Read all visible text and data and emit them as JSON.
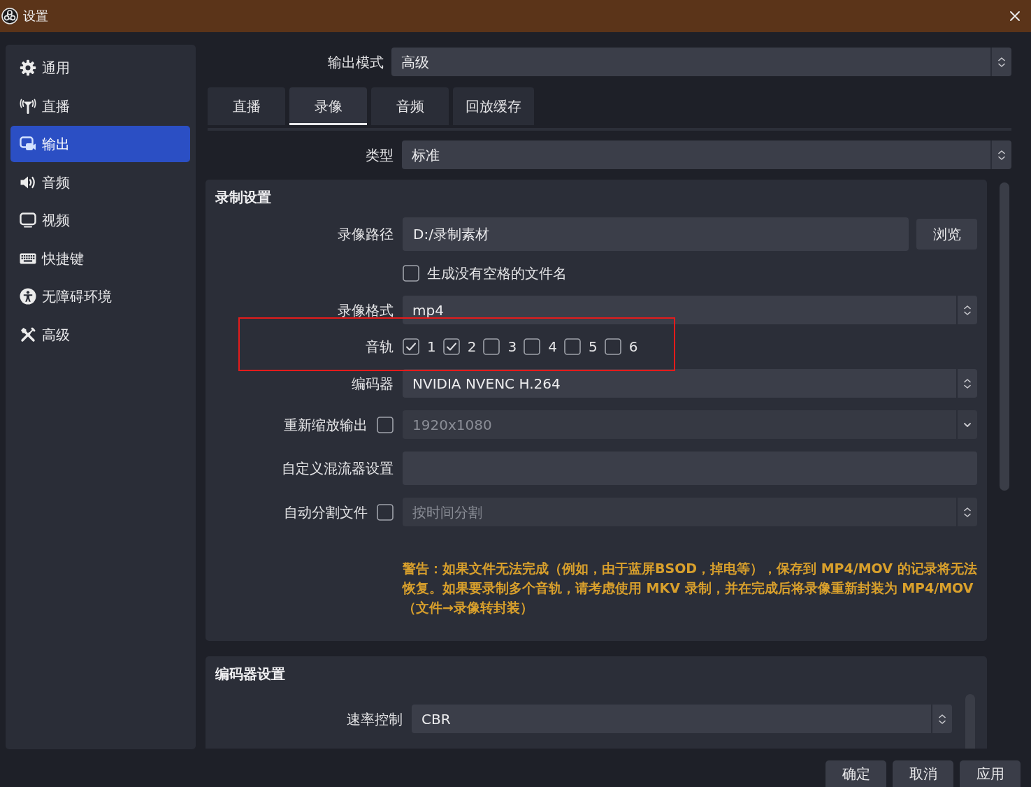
{
  "window": {
    "title": "设置"
  },
  "sidebar": {
    "items": [
      {
        "label": "通用",
        "selected": false
      },
      {
        "label": "直播",
        "selected": false
      },
      {
        "label": "输出",
        "selected": true
      },
      {
        "label": "音频",
        "selected": false
      },
      {
        "label": "视频",
        "selected": false
      },
      {
        "label": "快捷键",
        "selected": false
      },
      {
        "label": "无障碍环境",
        "selected": false
      },
      {
        "label": "高级",
        "selected": false
      }
    ]
  },
  "output_mode": {
    "kind": "field",
    "label": "输出模式",
    "field": {
      "kind": "select",
      "value": "高级",
      "disabled": false
    }
  },
  "tabs": [
    {
      "label": "直播",
      "selected": false
    },
    {
      "label": "录像",
      "selected": true
    },
    {
      "label": "音频",
      "selected": false
    },
    {
      "label": "回放缓存",
      "selected": false
    }
  ],
  "recording_type": {
    "kind": "field",
    "label": "类型",
    "field": {
      "kind": "select",
      "value": "标准",
      "disabled": false
    }
  },
  "recording_settings": {
    "title": "录制设置",
    "rows": [
      {
        "kind": "field",
        "label": "录像路径",
        "field": {
          "kind": "text",
          "value": "D:/录制素材",
          "disabled": false
        },
        "button": "浏览"
      },
      {
        "kind": "checkbox",
        "label": "生成没有空格的文件名",
        "checked": false
      },
      {
        "kind": "field",
        "label": "录像格式",
        "field": {
          "kind": "select",
          "value": "mp4",
          "disabled": false
        }
      },
      {
        "kind": "tracks",
        "label": "音轨",
        "highlighted": true,
        "tracks": [
          {
            "label": "1",
            "checked": true
          },
          {
            "label": "2",
            "checked": true
          },
          {
            "label": "3",
            "checked": false
          },
          {
            "label": "4",
            "checked": false
          },
          {
            "label": "5",
            "checked": false
          },
          {
            "label": "6",
            "checked": false
          }
        ]
      },
      {
        "kind": "field",
        "label": "编码器",
        "field": {
          "kind": "select",
          "value": "NVIDIA NVENC H.264",
          "disabled": false
        }
      },
      {
        "kind": "field",
        "label": "重新缩放输出",
        "checked": false,
        "field": {
          "kind": "combo",
          "value": "1920x1080",
          "disabled": true
        }
      },
      {
        "kind": "field",
        "label": "自定义混流器设置",
        "field": {
          "kind": "text"
        }
      },
      {
        "kind": "field",
        "label": "自动分割文件",
        "checked": false,
        "field": {
          "kind": "select",
          "value": "按时间分割",
          "disabled": true
        }
      },
      {
        "kind": "warning",
        "text": "警告：如果文件无法完成（例如，由于蓝屏BSOD，掉电等），保存到 MP4/MOV 的记录将无法恢复。如果要录制多个音轨，请考虑使用 MKV 录制，并在完成后将录像重新封装为 MP4/MOV（文件→录像转封装）"
      }
    ]
  },
  "encoder_settings": {
    "title": "编码器设置",
    "rows": [
      {
        "kind": "field",
        "label": "速率控制",
        "field": {
          "kind": "select",
          "value": "CBR",
          "disabled": false
        }
      }
    ]
  },
  "buttons": [
    "确定",
    "取消",
    "应用"
  ]
}
